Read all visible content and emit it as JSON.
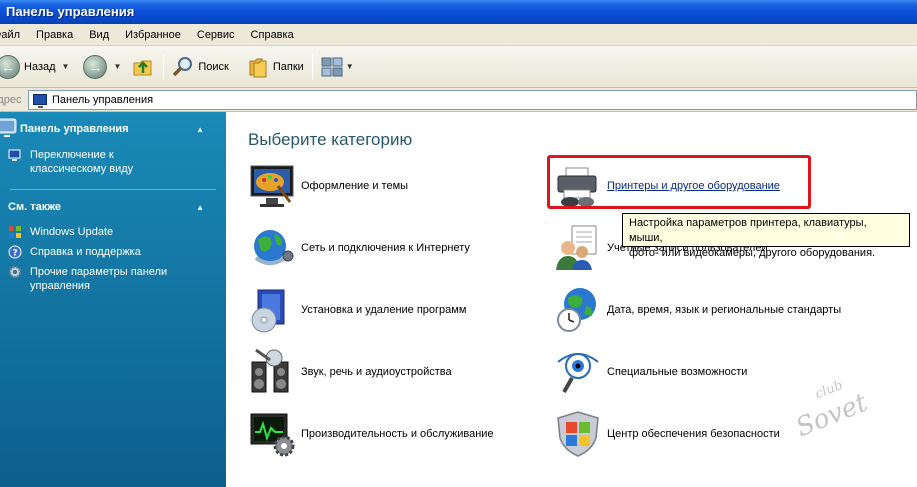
{
  "window": {
    "title": "Панель управления"
  },
  "menu": [
    "Файл",
    "Правка",
    "Вид",
    "Избранное",
    "Сервис",
    "Справка"
  ],
  "toolbar": {
    "back": "Назад",
    "search": "Поиск",
    "folders": "Папки"
  },
  "address": {
    "label": "Адрес",
    "value": "Панель управления"
  },
  "leftpane": {
    "panel_title": "Панель управления",
    "switch_view": "Переключение к классическому виду",
    "see_also_title": "См. также",
    "see_also": [
      {
        "label": "Windows Update",
        "icon": "windows-update-icon"
      },
      {
        "label": "Справка и поддержка",
        "icon": "help-icon"
      },
      {
        "label": "Прочие параметры панели управления",
        "icon": "gear-icon"
      }
    ]
  },
  "content": {
    "heading": "Выберите категорию",
    "categories_left": [
      "Оформление и темы",
      "Сеть и подключения к Интернету",
      "Установка и удаление программ",
      "Звук, речь и аудиоустройства",
      "Производительность и обслуживание"
    ],
    "categories_right": [
      "Принтеры и другое оборудование",
      "Учетные записи пользователей",
      "Дата, время, язык и региональные стандарты",
      "Специальные возможности",
      "Центр обеспечения безопасности"
    ]
  },
  "tooltip": {
    "line1": "Настройка параметров принтера, клавиатуры, мыши,",
    "line2": "фото- или видеокамеры, другого оборудования."
  },
  "watermark": {
    "top": "club",
    "bottom": "Sovet"
  },
  "colors": {
    "titlebar": "#0a50d8",
    "leftpane": "#1478a6",
    "highlight": "#e0141c",
    "tooltip": "#ffffe1",
    "heading": "#25586e"
  }
}
